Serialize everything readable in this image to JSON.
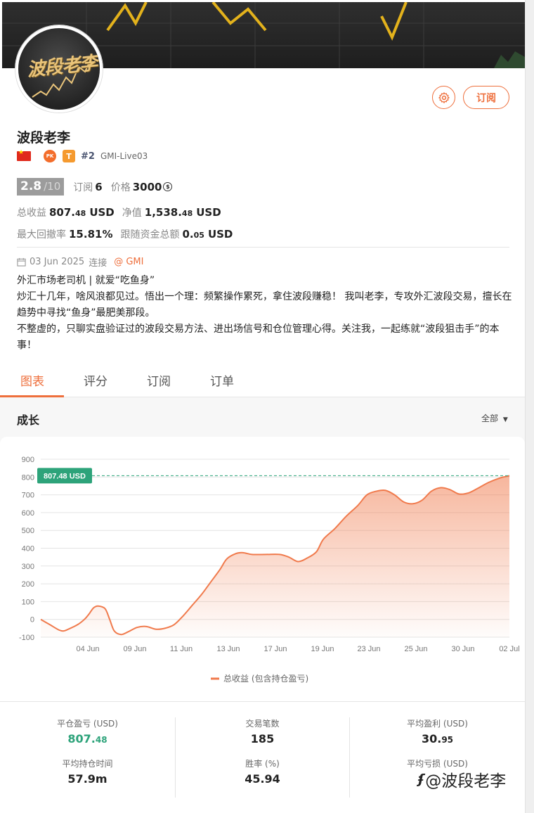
{
  "profile": {
    "name": "波段老李",
    "avatar_text": "波段老李",
    "rank": "#2",
    "server": "GMI-Live03",
    "pk_badge": "PK",
    "t_badge": "T",
    "subscribe_label": "订阅"
  },
  "stats": {
    "score": "2.8",
    "score_max": "/10",
    "subscribers_label": "订阅",
    "subscribers": "6",
    "price_label": "价格",
    "price": "3000",
    "coin_symbol": "$",
    "total_profit_label": "总收益",
    "total_profit_int": "807.",
    "total_profit_dec": "48",
    "total_profit_unit": "USD",
    "equity_label": "净值",
    "equity_int": "1,538.",
    "equity_dec": "48",
    "equity_unit": "USD",
    "max_drawdown_label": "最大回撤率",
    "max_drawdown": "15.81%",
    "follow_funds_label": "跟随资金总额",
    "follow_funds_int": "0.",
    "follow_funds_dec": "05",
    "follow_funds_unit": "USD"
  },
  "connection": {
    "date": "03 Jun 2025",
    "connect_label": "连接",
    "broker": "@ GMI"
  },
  "bio": {
    "line1": "外汇市场老司机 | 就爱“吃鱼身”",
    "line2": "炒汇十几年，啥风浪都见过。悟出一个理：频繁操作累死，拿住波段赚稳！ 我叫老李，专攻外汇波段交易，擅长在趋势中寻找“鱼身”最肥美那段。",
    "line3": "不整虚的，只聊实盘验证过的波段交易方法、进出场信号和仓位管理心得。关注我，一起练就“波段狙击手”的本事！"
  },
  "tabs": [
    {
      "label": "图表",
      "active": true
    },
    {
      "label": "评分",
      "active": false
    },
    {
      "label": "订阅",
      "active": false
    },
    {
      "label": "订单",
      "active": false
    }
  ],
  "chart_section": {
    "title": "成长",
    "range": "全部",
    "current_value_label": "807.48 USD"
  },
  "chart_data": {
    "type": "area",
    "title": "成长",
    "x_ticks": [
      "04 Jun",
      "09 Jun",
      "11 Jun",
      "13 Jun",
      "17 Jun",
      "19 Jun",
      "23 Jun",
      "25 Jun",
      "30 Jun",
      "02 Jul"
    ],
    "y_ticks": [
      "900",
      "800",
      "700",
      "600",
      "500",
      "400",
      "300",
      "200",
      "100",
      "0",
      "-100"
    ],
    "ylim": [
      -100,
      900
    ],
    "grid": true,
    "legend": "bottom-center",
    "series": [
      {
        "name": "总收益 (包含持仓盈亏)",
        "color": "#f07a4c",
        "points": [
          [
            0,
            0
          ],
          [
            0.4,
            -30
          ],
          [
            0.8,
            -60
          ],
          [
            1.0,
            -65
          ],
          [
            1.2,
            -55
          ],
          [
            1.6,
            -30
          ],
          [
            1.9,
            0
          ],
          [
            2.1,
            30
          ],
          [
            2.3,
            65
          ],
          [
            2.5,
            75
          ],
          [
            2.8,
            60
          ],
          [
            3.0,
            0
          ],
          [
            3.2,
            -65
          ],
          [
            3.5,
            -85
          ],
          [
            3.8,
            -70
          ],
          [
            4.2,
            -45
          ],
          [
            4.6,
            -40
          ],
          [
            5.0,
            -55
          ],
          [
            5.4,
            -50
          ],
          [
            5.8,
            -30
          ],
          [
            6.2,
            20
          ],
          [
            6.6,
            80
          ],
          [
            7.0,
            140
          ],
          [
            7.4,
            210
          ],
          [
            7.8,
            280
          ],
          [
            8.1,
            340
          ],
          [
            8.5,
            370
          ],
          [
            8.8,
            375
          ],
          [
            9.2,
            365
          ],
          [
            9.8,
            365
          ],
          [
            10.4,
            365
          ],
          [
            10.8,
            350
          ],
          [
            11.2,
            325
          ],
          [
            11.6,
            345
          ],
          [
            12.0,
            380
          ],
          [
            12.3,
            450
          ],
          [
            12.8,
            510
          ],
          [
            13.3,
            580
          ],
          [
            13.8,
            640
          ],
          [
            14.2,
            700
          ],
          [
            14.6,
            720
          ],
          [
            15.0,
            725
          ],
          [
            15.4,
            700
          ],
          [
            15.8,
            660
          ],
          [
            16.2,
            650
          ],
          [
            16.6,
            670
          ],
          [
            17.0,
            720
          ],
          [
            17.4,
            740
          ],
          [
            17.8,
            730
          ],
          [
            18.2,
            705
          ],
          [
            18.6,
            710
          ],
          [
            19.0,
            735
          ],
          [
            19.5,
            770
          ],
          [
            20.0,
            795
          ],
          [
            20.4,
            807.48
          ]
        ]
      }
    ],
    "current_value": 807.48
  },
  "summary": [
    {
      "label": "平仓盈亏 (USD)",
      "value_int": "807.",
      "value_dec": "48",
      "green": true
    },
    {
      "label": "交易笔数",
      "value_int": "185",
      "value_dec": "",
      "green": false
    },
    {
      "label": "平均盈利 (USD)",
      "value_int": "30.",
      "value_dec": "95",
      "green": false
    },
    {
      "label": "平均持仓时间",
      "value_int": "57.9m",
      "value_dec": "",
      "green": false
    },
    {
      "label": "胜率 (%)",
      "value_int": "45.94",
      "value_dec": "",
      "green": false
    },
    {
      "label": "平均亏损 (USD)",
      "value_int": "",
      "value_dec": "",
      "green": false
    }
  ],
  "watermark": "@波段老李",
  "colors": {
    "accent": "#ee6f3c",
    "green_badge": "#2da37a",
    "score_bg": "#9c9c9c"
  }
}
